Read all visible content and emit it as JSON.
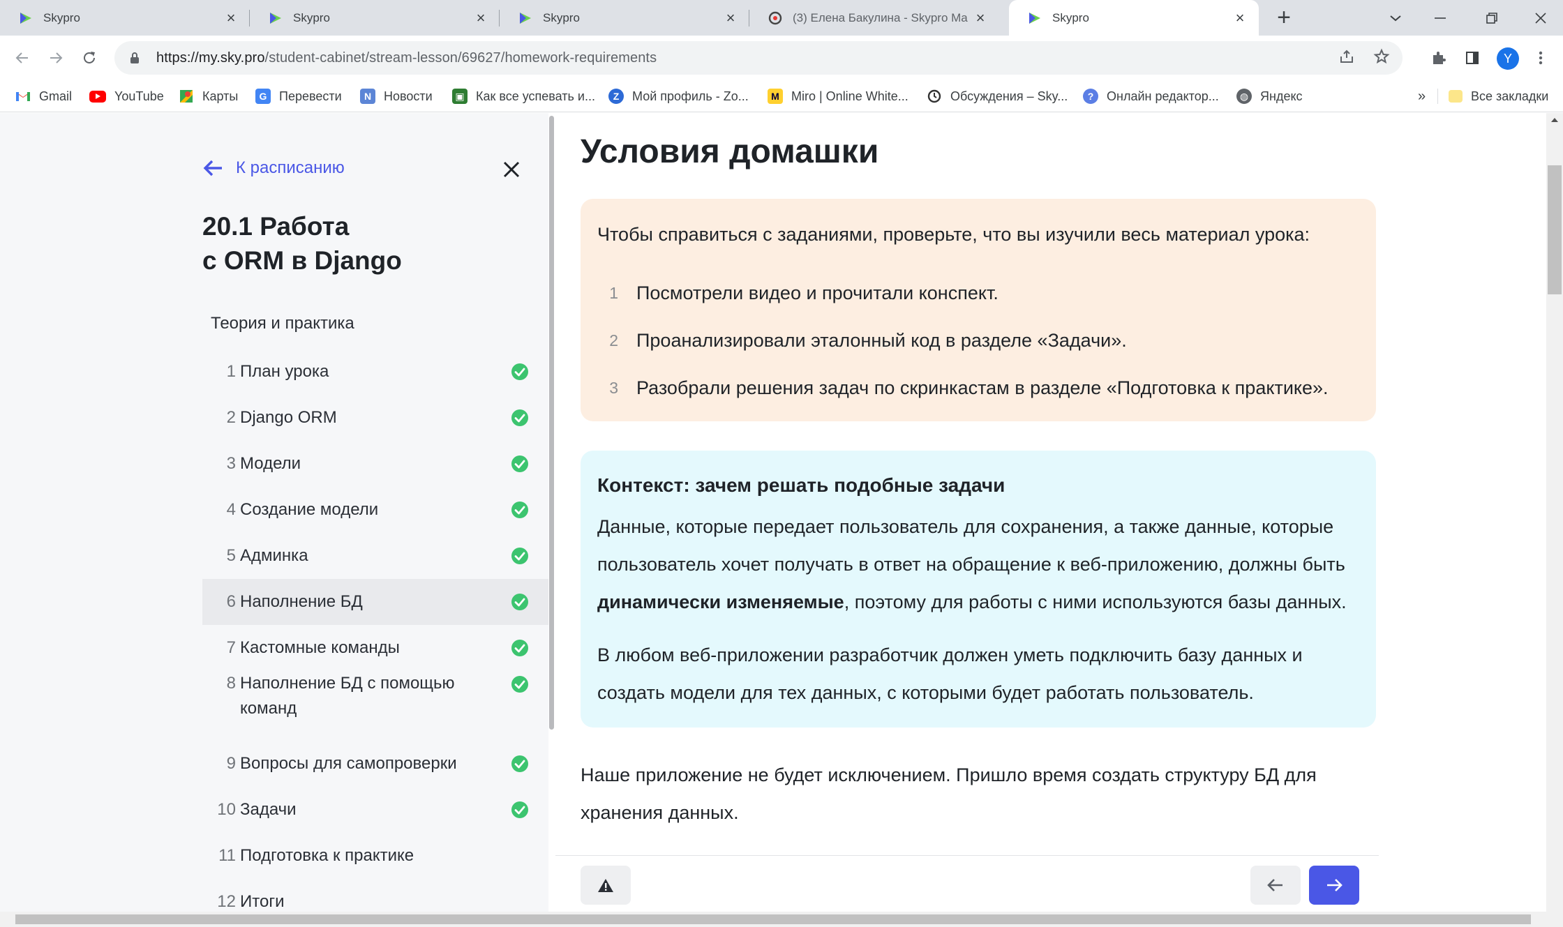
{
  "browser": {
    "tabs": [
      {
        "title": "Skypro",
        "icon": "skypro-favicon"
      },
      {
        "title": "Skypro",
        "icon": "skypro-favicon"
      },
      {
        "title": "Skypro",
        "icon": "skypro-favicon"
      },
      {
        "title": "(3) Елена Бакулина - Skypro Ma",
        "icon": "messenger-favicon"
      },
      {
        "title": "Skypro",
        "icon": "skypro-favicon"
      }
    ],
    "active_tab_index": 4,
    "url_host": "https://my.sky.pro",
    "url_path": "/student-cabinet/stream-lesson/69627/homework-requirements",
    "profile_initial": "Y",
    "bookmarks": [
      {
        "label": "Gmail",
        "icon": "gmail-icon"
      },
      {
        "label": "YouTube",
        "icon": "youtube-icon"
      },
      {
        "label": "Карты",
        "icon": "maps-icon"
      },
      {
        "label": "Перевести",
        "icon": "translate-icon"
      },
      {
        "label": "Новости",
        "icon": "news-icon"
      },
      {
        "label": "Как все успевать и...",
        "icon": "calendar-icon"
      },
      {
        "label": "Мой профиль - Zo...",
        "icon": "zoom-icon"
      },
      {
        "label": "Miro | Online White...",
        "icon": "miro-icon"
      },
      {
        "label": "Обсуждения – Sky...",
        "icon": "skypro-discuss-icon"
      },
      {
        "label": "Онлайн редактор...",
        "icon": "editor-icon"
      },
      {
        "label": "Яндекс",
        "icon": "globe-icon"
      }
    ],
    "bookmarks_overflow": "»",
    "all_bookmarks": "Все закладки"
  },
  "sidebar": {
    "back_label": "К расписанию",
    "lesson_title_line1": "20.1 Работа",
    "lesson_title_line2": "с ORM в Django",
    "section_label": "Теория и практика",
    "items": [
      {
        "num": "1",
        "label": "План урока",
        "done": true
      },
      {
        "num": "2",
        "label": "Django ORM",
        "done": true
      },
      {
        "num": "3",
        "label": "Модели",
        "done": true
      },
      {
        "num": "4",
        "label": "Создание модели",
        "done": true
      },
      {
        "num": "5",
        "label": "Админка",
        "done": true
      },
      {
        "num": "6",
        "label": "Наполнение БД",
        "done": true
      },
      {
        "num": "7",
        "label": "Кастомные команды",
        "done": true
      },
      {
        "num": "8",
        "label": "Наполнение БД с помощью команд",
        "done": true
      },
      {
        "num": "9",
        "label": "Вопросы для самопроверки",
        "done": true
      },
      {
        "num": "10",
        "label": "Задачи",
        "done": true
      },
      {
        "num": "11",
        "label": "Подготовка к практике",
        "done": false
      },
      {
        "num": "12",
        "label": "Итоги",
        "done": false
      }
    ],
    "active_item_index": 5
  },
  "main": {
    "heading": "Условия домашки",
    "checklist_intro": "Чтобы справиться с заданиями, проверьте, что вы изучили весь материал урока:",
    "checklist": [
      {
        "num": "1",
        "text": "Посмотрели видео и прочитали конспект."
      },
      {
        "num": "2",
        "text": "Проанализировали эталонный код в разделе «Задачи»."
      },
      {
        "num": "3",
        "text": "Разобрали решения задач по скринкастам в разделе «Подготовка к практике»."
      }
    ],
    "context_title": "Контекст: зачем решать подобные задачи",
    "context_p1_start": "Данные, которые передает пользователь для сохранения, а также данные, которые пользователь хочет получать в ответ на обращение к веб-приложению, должны быть ",
    "context_p1_bold": "динамически изменяемые",
    "context_p1_end": ", поэтому для работы с ними используются базы данных.",
    "context_p2": "В любом веб-приложении разработчик должен уметь подключить базу данных и создать модели для тех данных, с которыми будет работать пользователь.",
    "body_text": "Наше приложение не будет исключением. Пришло время создать структуру БД для хранения данных."
  },
  "colors": {
    "accent": "#4a57e6",
    "check_green": "#3cc46f",
    "peach_card": "#fdeee1",
    "cyan_card": "#e4f9fd"
  }
}
